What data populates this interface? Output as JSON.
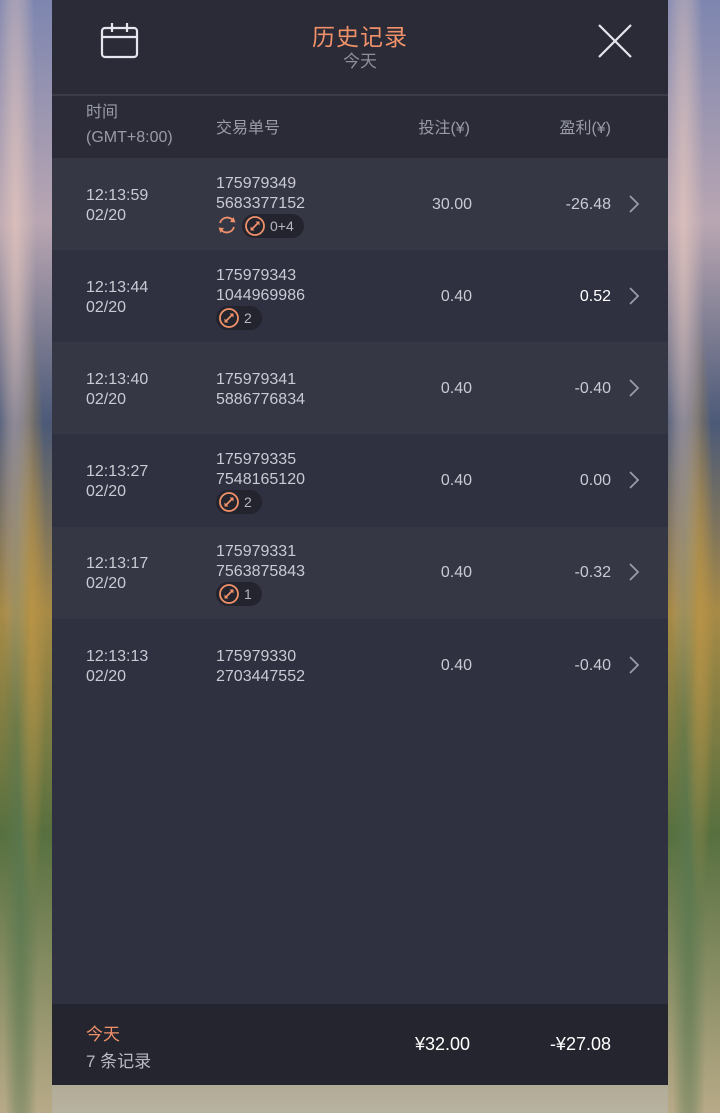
{
  "header": {
    "title": "历史记录",
    "subtitle": "今天",
    "calendar_icon": "calendar-icon",
    "close_icon": "close-icon"
  },
  "columns": {
    "time": "时间",
    "timezone": "(GMT+8:00)",
    "ticket": "交易单号",
    "bet": "投注(¥)",
    "profit": "盈利(¥)"
  },
  "rows": [
    {
      "time": "12:13:59",
      "date": "02/20",
      "ticket1": "175979349",
      "ticket2": "5683377152",
      "bet": "30.00",
      "profit": "-26.48",
      "badge": "0+4",
      "has_refresh": true
    },
    {
      "time": "12:13:44",
      "date": "02/20",
      "ticket1": "175979343",
      "ticket2": "1044969986",
      "bet": "0.40",
      "profit": "0.52",
      "badge": "2",
      "has_refresh": false
    },
    {
      "time": "12:13:40",
      "date": "02/20",
      "ticket1": "175979341",
      "ticket2": "5886776834",
      "bet": "0.40",
      "profit": "-0.40",
      "badge": "",
      "has_refresh": false
    },
    {
      "time": "12:13:27",
      "date": "02/20",
      "ticket1": "175979335",
      "ticket2": "7548165120",
      "bet": "0.40",
      "profit": "0.00",
      "badge": "2",
      "has_refresh": false
    },
    {
      "time": "12:13:17",
      "date": "02/20",
      "ticket1": "175979331",
      "ticket2": "7563875843",
      "bet": "0.40",
      "profit": "-0.32",
      "badge": "1",
      "has_refresh": false
    },
    {
      "time": "12:13:13",
      "date": "02/20",
      "ticket1": "175979330",
      "ticket2": "2703447552",
      "bet": "0.40",
      "profit": "-0.40",
      "badge": "",
      "has_refresh": false
    }
  ],
  "footer": {
    "label": "今天",
    "count": "7 条记录",
    "total_bet": "¥32.00",
    "total_profit": "-¥27.08"
  },
  "colors": {
    "accent": "#f0916a",
    "panel": "#2f3040",
    "header": "#2a2b37"
  }
}
